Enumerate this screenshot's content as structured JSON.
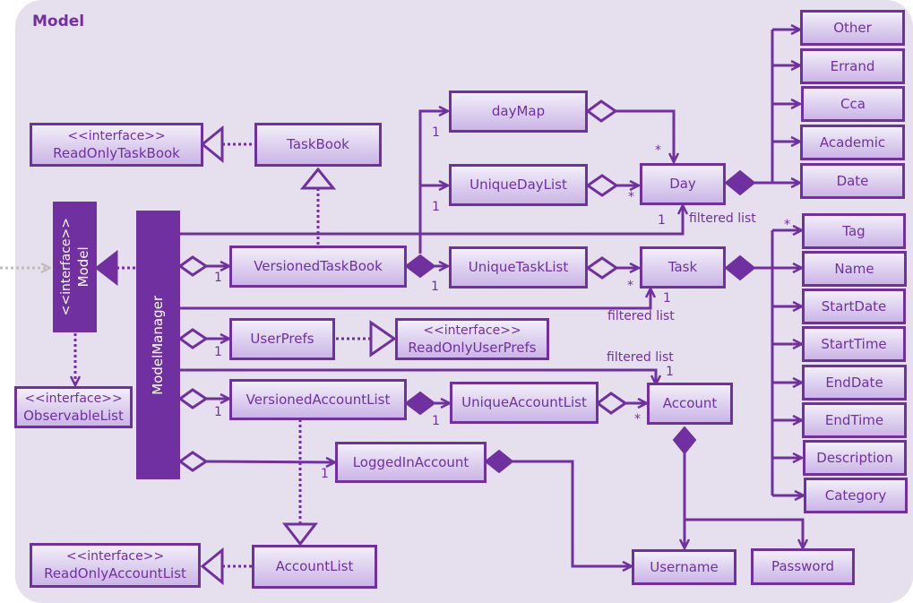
{
  "package": {
    "title": "Model"
  },
  "colors": {
    "primary": "#7030a0",
    "background": "#e6e0ee",
    "box_top": "#f2eef9",
    "box_bottom": "#cbb5e6",
    "external_arrow": "#bfbfbf"
  },
  "classes": {
    "readOnlyTaskBook": {
      "stereotype": "<<interface>>",
      "name": "ReadOnlyTaskBook"
    },
    "taskBook": {
      "name": "TaskBook"
    },
    "model": {
      "stereotype": "<<interface>>",
      "name": "Model"
    },
    "modelManager": {
      "name": "ModelManager"
    },
    "observableList": {
      "stereotype": "<<interface>>",
      "name": "ObservableList"
    },
    "versionedTaskBook": {
      "name": "VersionedTaskBook"
    },
    "dayMap": {
      "name": "dayMap"
    },
    "uniqueDayList": {
      "name": "UniqueDayList"
    },
    "day": {
      "name": "Day"
    },
    "uniqueTaskList": {
      "name": "UniqueTaskList"
    },
    "task": {
      "name": "Task"
    },
    "userPrefs": {
      "name": "UserPrefs"
    },
    "readOnlyUserPrefs": {
      "stereotype": "<<interface>>",
      "name": "ReadOnlyUserPrefs"
    },
    "versionedAccountList": {
      "name": "VersionedAccountList"
    },
    "uniqueAccountList": {
      "name": "UniqueAccountList"
    },
    "account": {
      "name": "Account"
    },
    "loggedInAccount": {
      "name": "LoggedInAccount"
    },
    "accountList": {
      "name": "AccountList"
    },
    "readOnlyAccountList": {
      "stereotype": "<<interface>>",
      "name": "ReadOnlyAccountList"
    },
    "username": {
      "name": "Username"
    },
    "password": {
      "name": "Password"
    },
    "other": {
      "name": "Other"
    },
    "errand": {
      "name": "Errand"
    },
    "cca": {
      "name": "Cca"
    },
    "academic": {
      "name": "Academic"
    },
    "date": {
      "name": "Date"
    },
    "tag": {
      "name": "Tag"
    },
    "nameAttr": {
      "name": "Name"
    },
    "startDate": {
      "name": "StartDate"
    },
    "startTime": {
      "name": "StartTime"
    },
    "endDate": {
      "name": "EndDate"
    },
    "endTime": {
      "name": "EndTime"
    },
    "description": {
      "name": "Description"
    },
    "category": {
      "name": "Category"
    }
  },
  "labels": {
    "filtered_day": "filtered list",
    "filtered_task": "filtered list",
    "filtered_account": "filtered list",
    "one": "1",
    "many": "*"
  }
}
